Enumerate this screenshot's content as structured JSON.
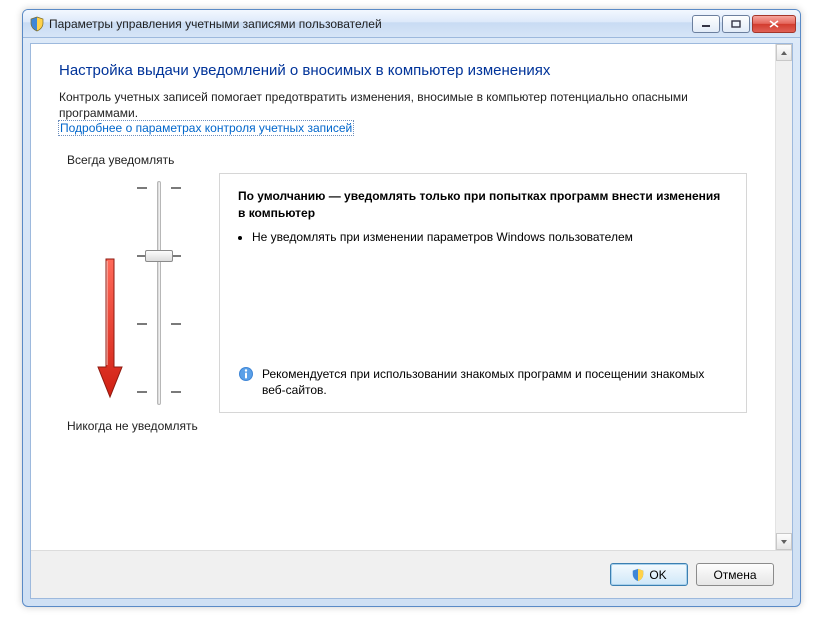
{
  "titlebar": {
    "title": "Параметры управления учетными записями пользователей"
  },
  "heading": "Настройка выдачи уведомлений о вносимых в компьютер изменениях",
  "intro": "Контроль учетных записей помогает предотвратить изменения, вносимые в компьютер потенциально опасными программами.",
  "link": "Подробнее о параметрах контроля учетных записей",
  "slider": {
    "top_label": "Всегда уведомлять",
    "bottom_label": "Никогда не уведомлять"
  },
  "description": {
    "title": "По умолчанию — уведомлять только при попытках программ внести изменения в компьютер",
    "items": [
      "Не уведомлять при изменении параметров Windows пользователем"
    ],
    "recommendation": "Рекомендуется при использовании знакомых программ и посещении знакомых веб-сайтов."
  },
  "footer": {
    "ok": "OK",
    "cancel": "Отмена"
  }
}
